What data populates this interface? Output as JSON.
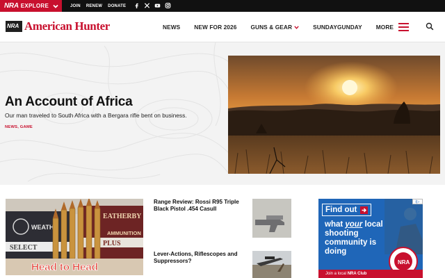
{
  "topbar": {
    "brand": "NRA",
    "explore": "EXPLORE",
    "links": [
      "JOIN",
      "RENEW",
      "DONATE"
    ],
    "social_icons": [
      "facebook-icon",
      "x-icon",
      "youtube-icon",
      "instagram-icon"
    ],
    "colors": {
      "brand_red": "#c8102e",
      "bar": "#111111"
    }
  },
  "header": {
    "logo_text": "American Hunter",
    "nav": [
      "NEWS",
      "NEW FOR 2026",
      "GUNS & GEAR",
      "SUNDAYGUNDAY",
      "MORE"
    ],
    "search_icon": "search-icon"
  },
  "hero": {
    "title": "An Account of Africa",
    "subtitle": "Our man traveled to South Africa with a Bergara rifle bent on business.",
    "tags": "NEWS, GAME"
  },
  "stories": [
    {
      "title": "Range Review: Rossi R95 Triple Black Pistol .454 Casull"
    },
    {
      "title": "Lever-Actions, Riflescopes and Suppressors?"
    }
  ],
  "feature_card": {
    "box_top": "SELECT",
    "box_bottom": "PLUS",
    "box_brand": "WEATHERBY",
    "box_ammo": "AMMUNITION",
    "banner": "Head to Head"
  },
  "ad": {
    "cta": "Find out",
    "line_before": "what ",
    "line_emph": "your",
    "line_after": " local shooting community is doing",
    "foot_pre": "Join a local ",
    "foot_bold": "NRA Club",
    "seal_text": "CLUBS AND ASSOCIATIONS",
    "seal_center": "NRA",
    "info": "i▷",
    "colors": {
      "ad_blue": "#1f66b8",
      "ad_red": "#c8102e"
    }
  }
}
